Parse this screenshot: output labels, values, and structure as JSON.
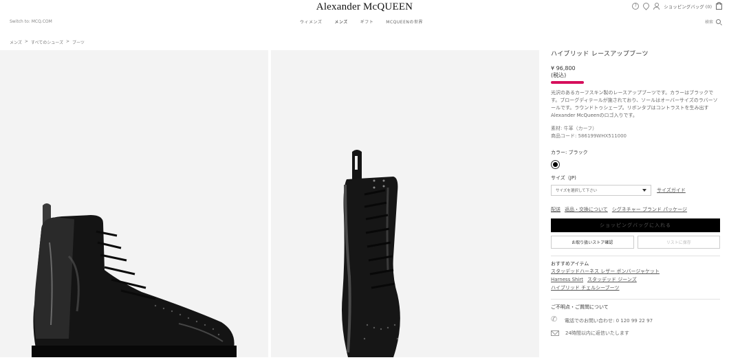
{
  "header": {
    "logo": "Alexander McQUEEN",
    "switch_link": "Switch to: MCQ.COM",
    "nav": [
      "ウィメンズ",
      "メンズ",
      "ギフト",
      "MCQUEENの世界"
    ],
    "help_icon_label": "?",
    "bag_label": "ショッピングバッグ (0)",
    "search_label": "検索"
  },
  "breadcrumb": [
    "メンズ",
    ">",
    "すべてのシューズ",
    ">",
    "ブーツ"
  ],
  "product": {
    "title": "ハイブリッド レースアップブーツ",
    "price": "¥ 96,800",
    "tax_note": "(税込)",
    "description": "光沢のあるカーフスキン製のレースアップブーツです。カラーはブラックです。ブローグディテールが施されており、ソールはオーバーサイズのラバーソールです。ラウンドトゥシェープ。リボンタブはコントラストを生み出すAlexander McQueenのロゴ入りです。",
    "material": "素材: 牛革（カーフ）",
    "code": "商品コード:  586199WHX511000",
    "color_label": "カラー: ブラック",
    "size_label": "サイズ（JP)",
    "size_placeholder": "サイズを選択して下さい",
    "size_guide": "サイズガイド",
    "links": [
      "配送",
      "返品・交換について",
      "シグネチャー ブランド パッケージ"
    ],
    "add_to_bag": "ショッピングバッグに入れる",
    "store_check": "お取り扱いストア確認",
    "wishlist": "リストに保存"
  },
  "recommend": {
    "title": "おすすめアイテム",
    "items": [
      "スタッデッドハーネス レザー ボンバージャケット",
      "Harness Shirt",
      "スタッデッド ジーンズ",
      "ハイブリッド チェルシーブーツ"
    ]
  },
  "contact": {
    "title": "ご不明点・ご質問について",
    "phone": "電話でのお問い合わせ: 0 120 99 22 97",
    "mail": "24時間以内に返信いたします"
  },
  "colors": {
    "highlight": "#d60f5c",
    "swatch": "#000000"
  }
}
